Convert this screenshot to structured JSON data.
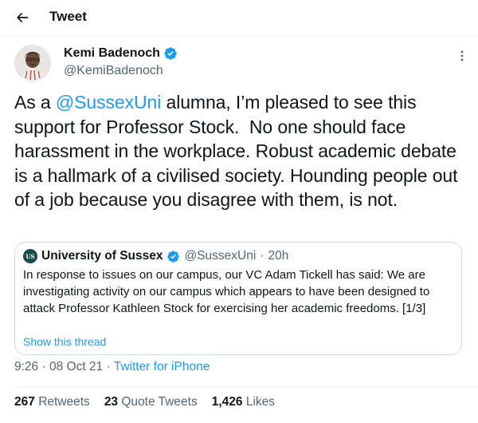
{
  "header": {
    "title": "Tweet",
    "back_icon": "arrow-left-icon"
  },
  "author": {
    "display_name": "Kemi Badenoch",
    "handle": "@KemiBadenoch",
    "verified": true,
    "verified_color": "#1d9bf0"
  },
  "tweet": {
    "text_prefix": "As a ",
    "mention": "@SussexUni",
    "text_suffix": " alumna, I’m pleased to see this support for Professor Stock.  No one should face harassment in the workplace. Robust academic debate is a hallmark of a civilised society. Hounding people out of a job because you disagree with them, is not."
  },
  "quoted": {
    "logo_text": "US",
    "display_name": "University of Sussex",
    "handle": "@SussexUni",
    "separator": "·",
    "time": "20h",
    "text": "In response to issues on our campus, our VC Adam Tickell has said: We are investigating activity on our campus which appears to have been designed to attack Professor Kathleen Stock for exercising her academic freedoms. [1/3]",
    "thread_link": "Show this thread"
  },
  "meta": {
    "time": "9:26",
    "date": "08 Oct 21",
    "separator": "·",
    "source": "Twitter for iPhone"
  },
  "stats": {
    "retweets_count": "267",
    "retweets_label": "Retweets",
    "quotes_count": "23",
    "quotes_label": "Quote Tweets",
    "likes_count": "1,426",
    "likes_label": "Likes"
  },
  "colors": {
    "link": "#1d9bf0",
    "secondary_text": "#536471",
    "border": "#cfd9de"
  }
}
